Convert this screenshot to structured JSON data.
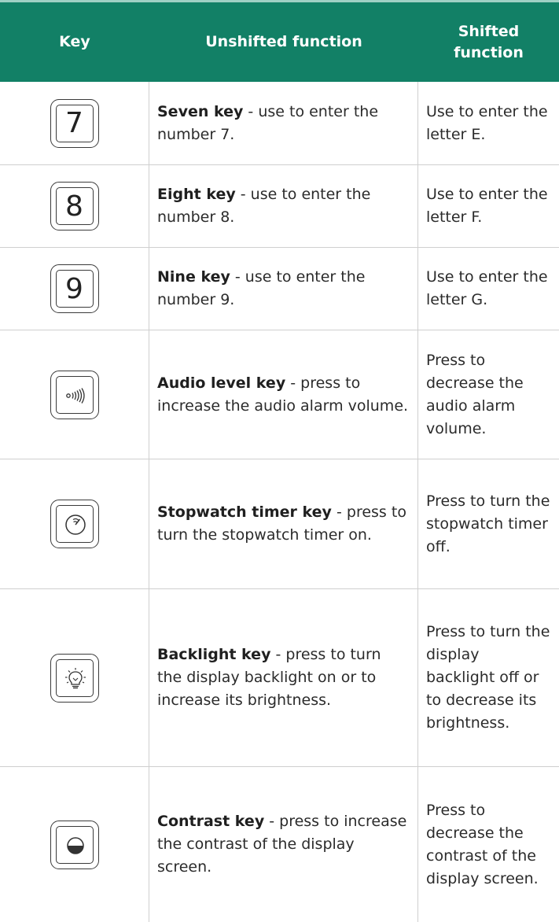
{
  "header": {
    "key": "Key",
    "unshifted": "Unshifted function",
    "shifted_line1": "Shifted",
    "shifted_line2": "function"
  },
  "rows": [
    {
      "key_label": "7",
      "unshifted_bold": "Seven key",
      "unshifted_rest": " - use to enter the number 7.",
      "shifted": "Use to enter the letter E."
    },
    {
      "key_label": "8",
      "unshifted_bold": "Eight key",
      "unshifted_rest": " - use to enter the number 8.",
      "shifted": "Use to enter the letter F."
    },
    {
      "key_label": "9",
      "unshifted_bold": "Nine key",
      "unshifted_rest": " - use to enter the number 9.",
      "shifted": "Use to enter the letter G."
    },
    {
      "key_icon": "audio-level-icon",
      "unshifted_bold": "Audio level key",
      "unshifted_rest": " - press to increase the audio alarm volume.",
      "shifted": "Press to decrease the audio alarm volume."
    },
    {
      "key_icon": "stopwatch-icon",
      "unshifted_bold": "Stopwatch timer key",
      "unshifted_rest": " - press to turn the stopwatch timer on.",
      "shifted": "Press to turn the stopwatch timer off."
    },
    {
      "key_icon": "backlight-bulb-icon",
      "unshifted_bold": "Backlight key",
      "unshifted_rest": " - press to turn the display backlight on or to increase its brightness.",
      "shifted": "Press to turn the display backlight off or to decrease its brightness."
    },
    {
      "key_icon": "contrast-icon",
      "unshifted_bold": "Contrast key",
      "unshifted_rest": " - press to increase the contrast of the display screen.",
      "shifted": "Press to decrease the contrast of the display screen."
    }
  ],
  "colors": {
    "header_bg": "#128066",
    "header_text": "#ffffff",
    "grid": "#cfcfcf"
  }
}
